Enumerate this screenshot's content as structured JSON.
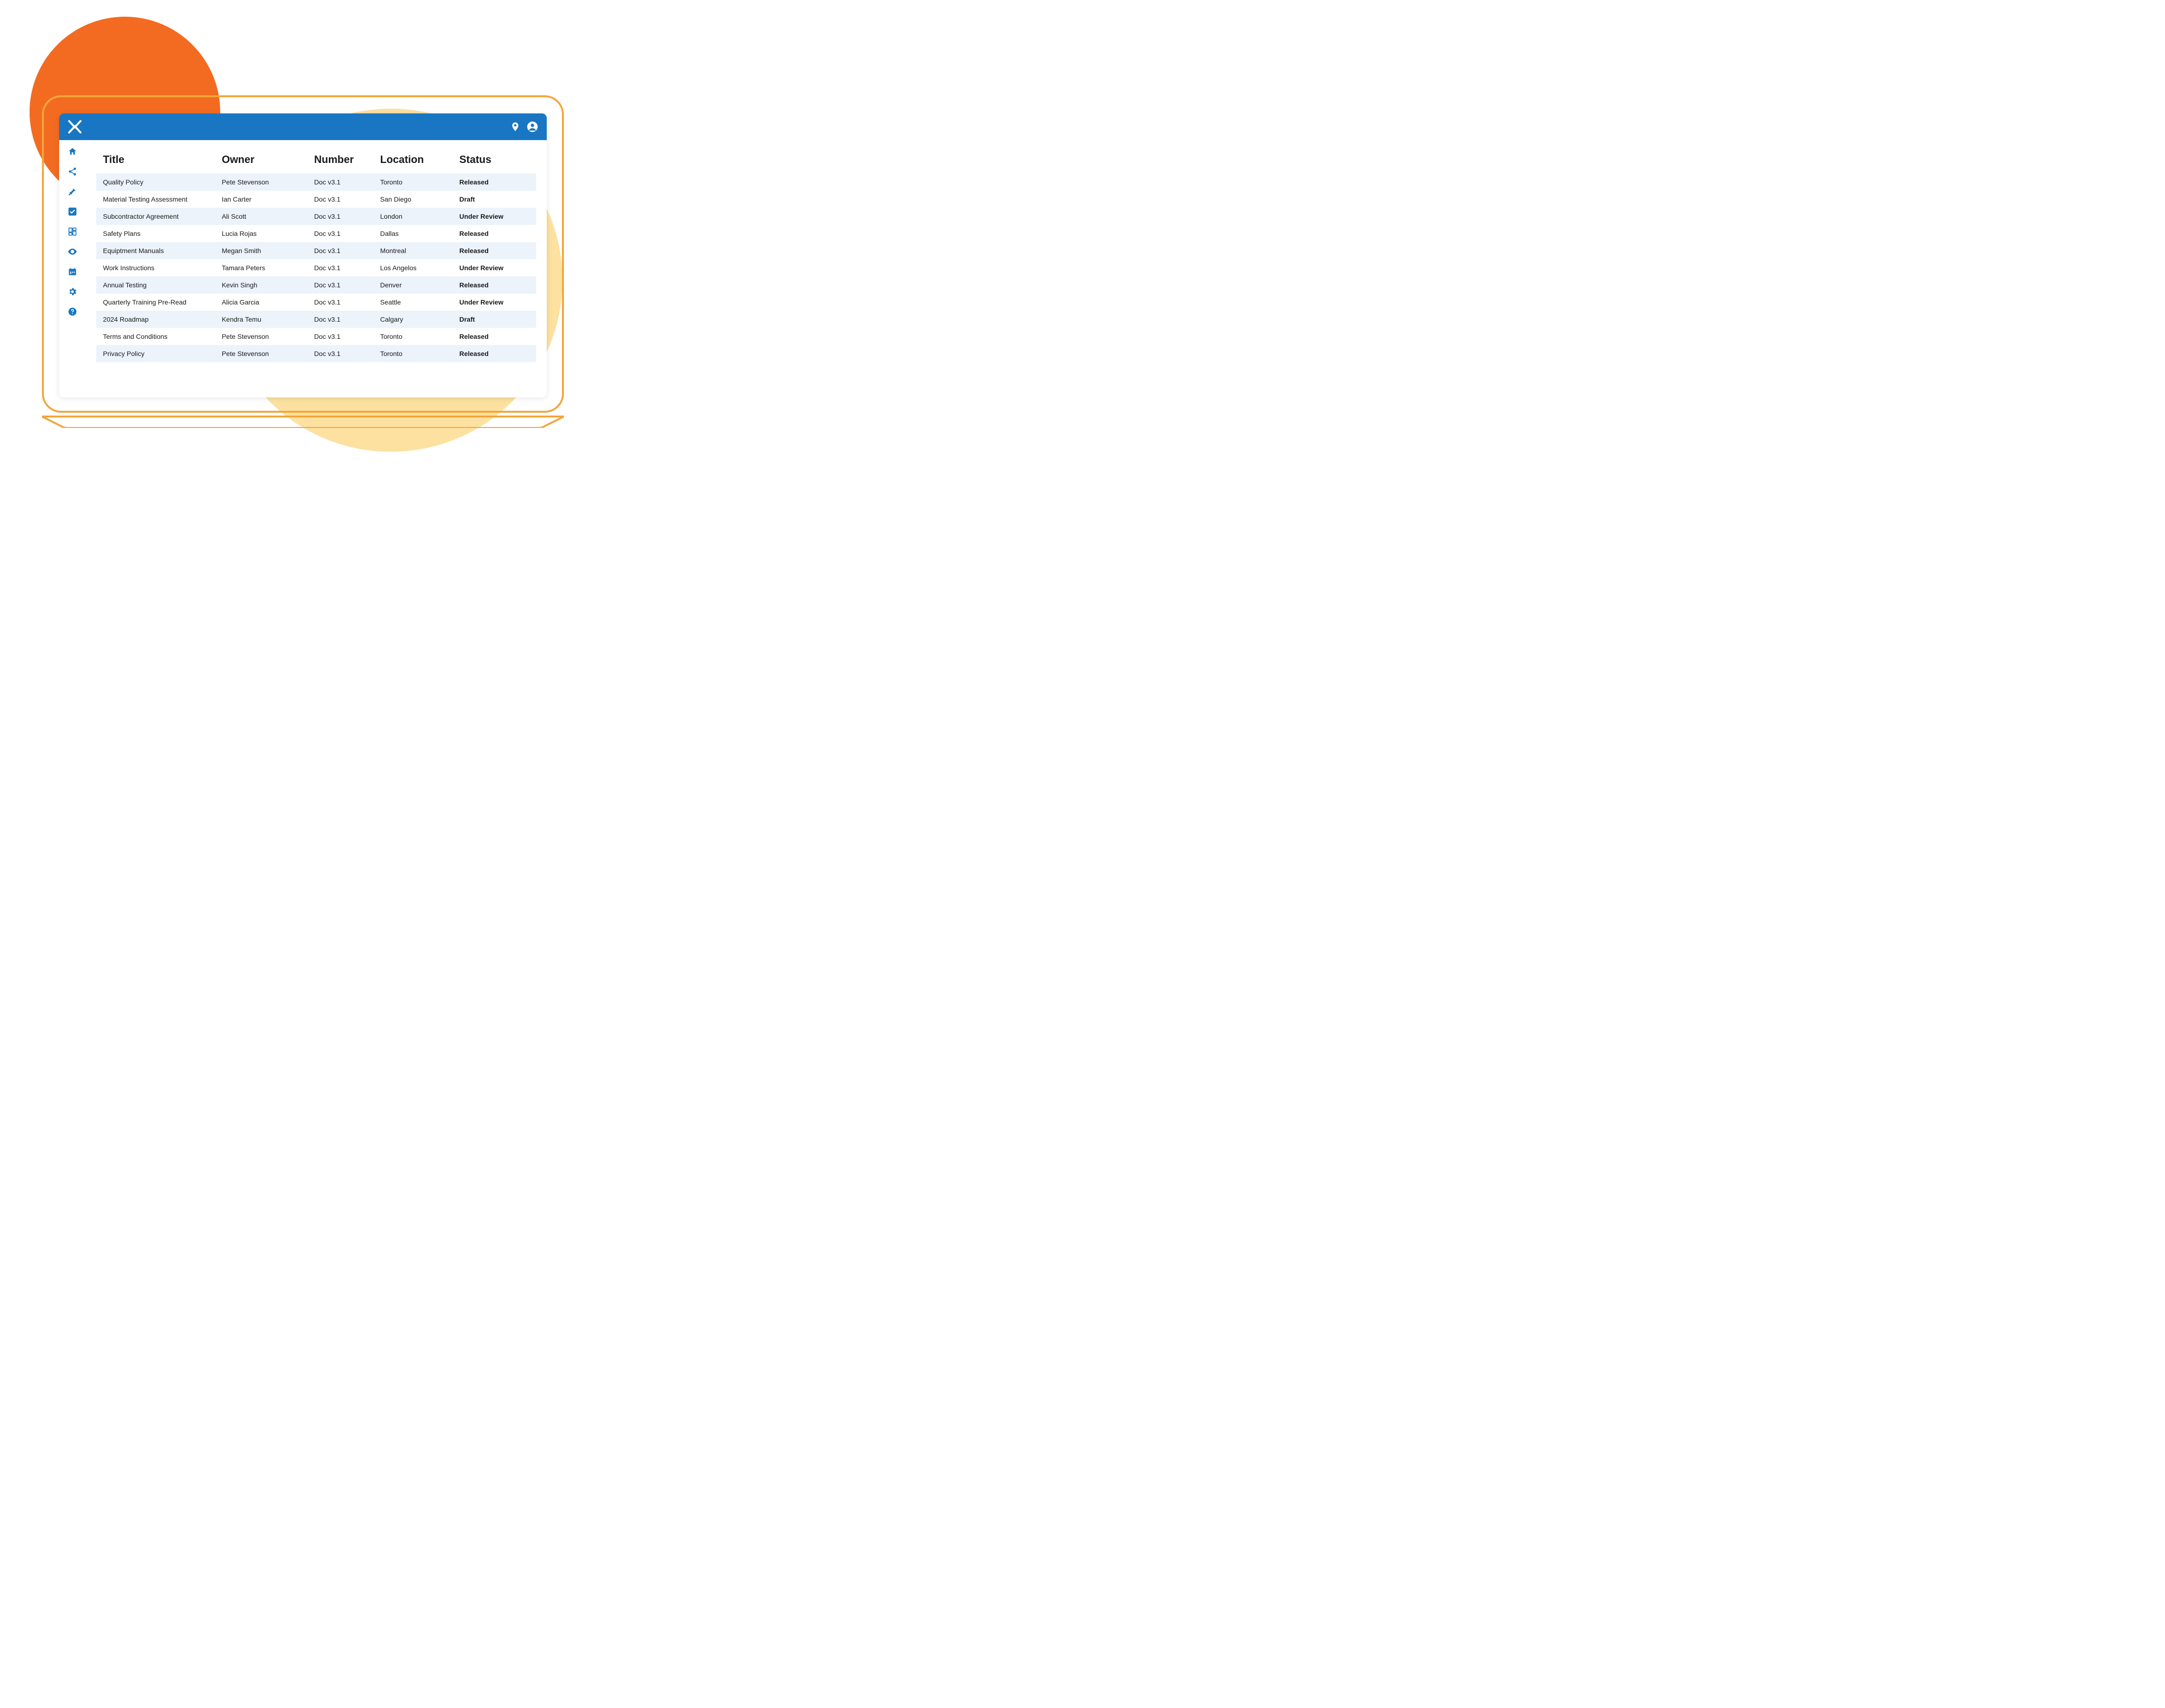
{
  "header": {
    "icons": [
      "location-pin-icon",
      "user-account-icon"
    ]
  },
  "sidebar": {
    "items": [
      {
        "name": "home-icon"
      },
      {
        "name": "share-icon"
      },
      {
        "name": "pin-icon"
      },
      {
        "name": "check-icon"
      },
      {
        "name": "dashboard-icon"
      },
      {
        "name": "eye-icon"
      },
      {
        "name": "calendar-icon"
      },
      {
        "name": "gear-icon"
      },
      {
        "name": "help-icon"
      }
    ]
  },
  "table": {
    "headers": {
      "title": "Title",
      "owner": "Owner",
      "number": "Number",
      "location": "Location",
      "status": "Status"
    },
    "rows": [
      {
        "title": "Quality Policy",
        "owner": "Pete Stevenson",
        "number": "Doc v3.1",
        "location": "Toronto",
        "status": "Released"
      },
      {
        "title": "Material Testing Assessment",
        "owner": "Ian Carter",
        "number": "Doc v3.1",
        "location": "San Diego",
        "status": "Draft"
      },
      {
        "title": "Subcontractor Agreement",
        "owner": "Ali Scott",
        "number": "Doc v3.1",
        "location": "London",
        "status": "Under Review"
      },
      {
        "title": "Safety Plans",
        "owner": "Lucia Rojas",
        "number": "Doc v3.1",
        "location": "Dallas",
        "status": "Released"
      },
      {
        "title": "Equiptment Manuals",
        "owner": "Megan Smith",
        "number": "Doc v3.1",
        "location": "Montreal",
        "status": "Released"
      },
      {
        "title": "Work Instructions",
        "owner": "Tamara Peters",
        "number": "Doc v3.1",
        "location": "Los Angelos",
        "status": "Under Review"
      },
      {
        "title": "Annual Testing",
        "owner": "Kevin Singh",
        "number": "Doc v3.1",
        "location": "Denver",
        "status": "Released"
      },
      {
        "title": "Quarterly Training Pre-Read",
        "owner": "Alicia Garcia",
        "number": "Doc v3.1",
        "location": "Seattle",
        "status": "Under Review"
      },
      {
        "title": "2024 Roadmap",
        "owner": "Kendra Temu",
        "number": "Doc v3.1",
        "location": "Calgary",
        "status": "Draft"
      },
      {
        "title": "Terms and Conditions",
        "owner": "Pete Stevenson",
        "number": "Doc v3.1",
        "location": "Toronto",
        "status": "Released"
      },
      {
        "title": "Privacy Policy",
        "owner": "Pete Stevenson",
        "number": "Doc v3.1",
        "location": "Toronto",
        "status": "Released"
      }
    ]
  },
  "colors": {
    "brand_blue": "#1976c2",
    "accent_amber": "#f2a63a",
    "circle_orange": "#f36b21",
    "circle_yellow": "#fce1a0",
    "status_released": "#179b4f",
    "status_under_review": "#f2a63a",
    "status_draft": "#e96a1e"
  }
}
